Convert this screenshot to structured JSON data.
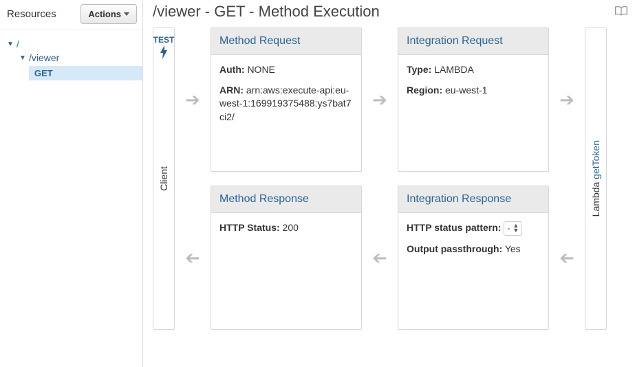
{
  "sidebar": {
    "title": "Resources",
    "actions_label": "Actions",
    "tree": {
      "root": "/",
      "child": "/viewer",
      "method": "GET"
    }
  },
  "header": {
    "title": "/viewer - GET - Method Execution"
  },
  "client": {
    "label": "Client",
    "test_label": "TEST"
  },
  "lambda": {
    "prefix": "Lambda ",
    "name": "getToken"
  },
  "cards": {
    "method_request": {
      "title": "Method Request",
      "auth_label": "Auth:",
      "auth_value": "NONE",
      "arn_label": "ARN:",
      "arn_value": "arn:aws:execute-api:eu-west-1:169919375488:ys7bat7ci2/"
    },
    "integration_request": {
      "title": "Integration Request",
      "type_label": "Type:",
      "type_value": "LAMBDA",
      "region_label": "Region:",
      "region_value": "eu-west-1"
    },
    "method_response": {
      "title": "Method Response",
      "status_label": "HTTP Status:",
      "status_value": "200"
    },
    "integration_response": {
      "title": "Integration Response",
      "pattern_label": "HTTP status pattern:",
      "pattern_value": "-",
      "passthrough_label": "Output passthrough:",
      "passthrough_value": "Yes"
    }
  }
}
